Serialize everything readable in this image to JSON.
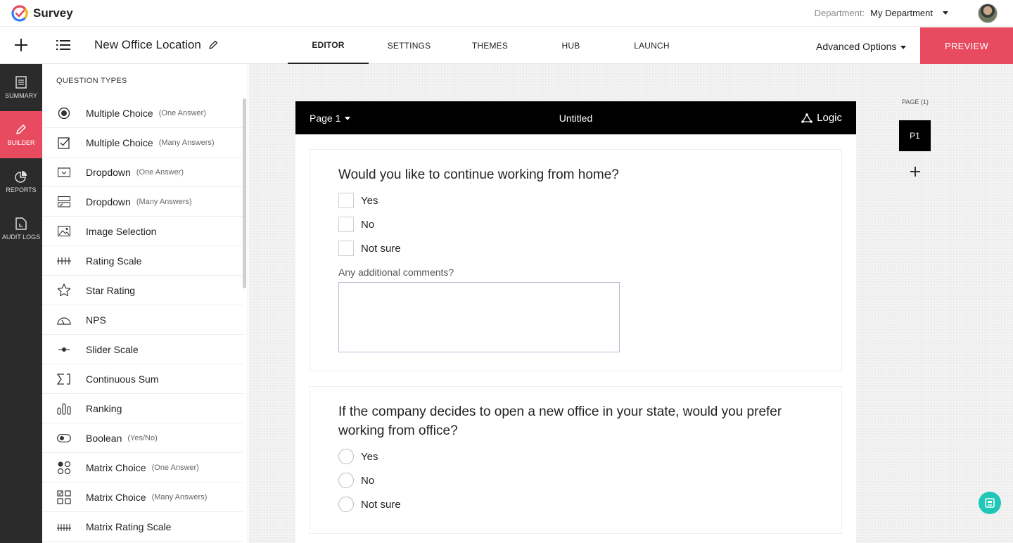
{
  "app": {
    "name": "Survey"
  },
  "department": {
    "label": "Department:",
    "value": "My Department"
  },
  "survey": {
    "name": "New Office Location"
  },
  "tabs": [
    {
      "label": "EDITOR"
    },
    {
      "label": "SETTINGS"
    },
    {
      "label": "THEMES"
    },
    {
      "label": "HUB"
    },
    {
      "label": "LAUNCH"
    }
  ],
  "toolbar": {
    "advanced_options": "Advanced Options",
    "preview": "PREVIEW"
  },
  "rail": [
    {
      "label": "SUMMARY",
      "icon": "document-icon"
    },
    {
      "label": "BUILDER",
      "icon": "pencil-icon"
    },
    {
      "label": "REPORTS",
      "icon": "pie-chart-icon"
    },
    {
      "label": "AUDIT LOGS",
      "icon": "log-file-icon"
    }
  ],
  "question_types": {
    "title": "QUESTION TYPES",
    "items": [
      {
        "label": "Multiple Choice",
        "sub": "(One Answer)"
      },
      {
        "label": "Multiple Choice",
        "sub": "(Many Answers)"
      },
      {
        "label": "Dropdown",
        "sub": "(One Answer)"
      },
      {
        "label": "Dropdown",
        "sub": "(Many Answers)"
      },
      {
        "label": "Image Selection",
        "sub": ""
      },
      {
        "label": "Rating Scale",
        "sub": ""
      },
      {
        "label": "Star Rating",
        "sub": ""
      },
      {
        "label": "NPS",
        "sub": ""
      },
      {
        "label": "Slider Scale",
        "sub": ""
      },
      {
        "label": "Continuous Sum",
        "sub": ""
      },
      {
        "label": "Ranking",
        "sub": ""
      },
      {
        "label": "Boolean",
        "sub": "(Yes/No)"
      },
      {
        "label": "Matrix Choice",
        "sub": "(One Answer)"
      },
      {
        "label": "Matrix Choice",
        "sub": "(Many Answers)"
      },
      {
        "label": "Matrix Rating Scale",
        "sub": ""
      }
    ]
  },
  "page": {
    "selector": "Page 1",
    "title": "Untitled",
    "logic": "Logic"
  },
  "questions": [
    {
      "text": "Would you like to continue working from home?",
      "options": [
        "Yes",
        "No",
        "Not sure"
      ],
      "comment_label": "Any additional comments?"
    },
    {
      "text": "If the company decides to open a new office in your state, would you prefer working from office?",
      "options": [
        "Yes",
        "No",
        "Not sure"
      ]
    }
  ],
  "page_nav": {
    "label": "PAGE (1)",
    "thumb": "P1"
  },
  "colors": {
    "accent": "#e84b5f",
    "rail": "#2b2b2b",
    "help": "#20c7b7"
  }
}
